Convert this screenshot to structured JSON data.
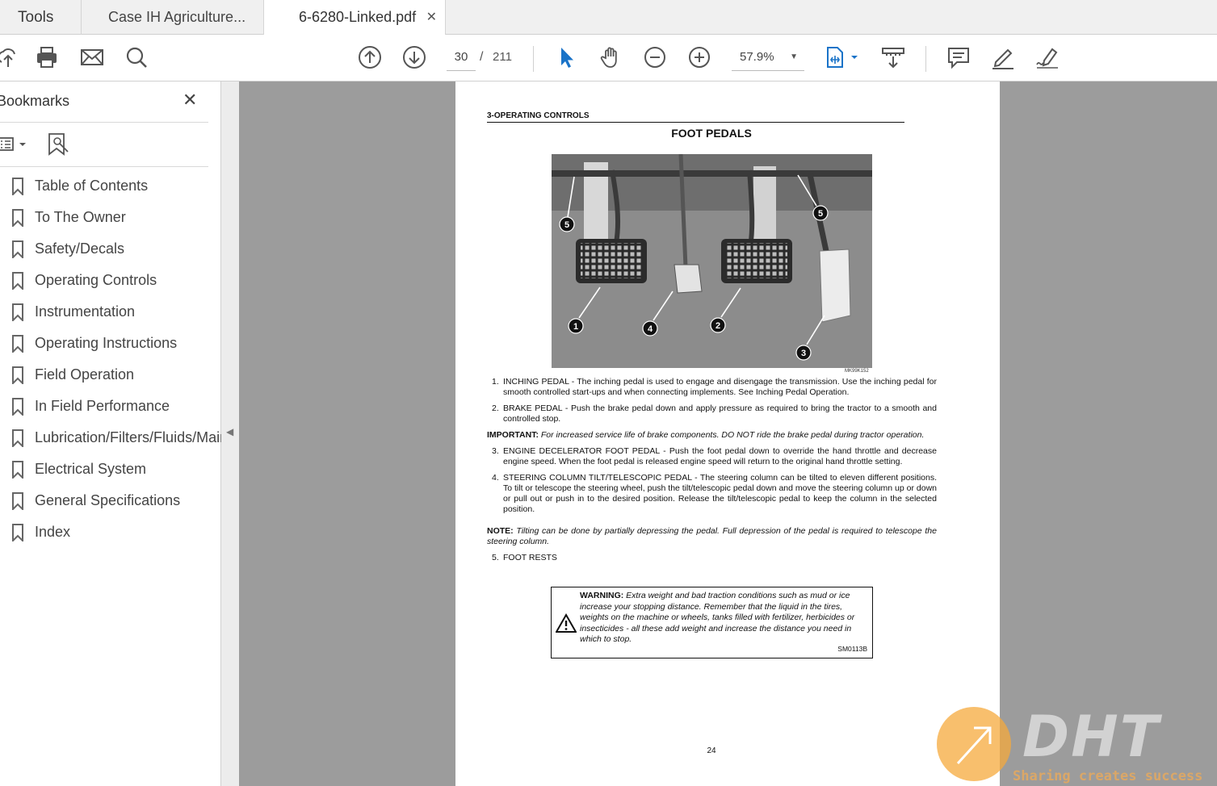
{
  "tabs": {
    "tools": "Tools",
    "doc1": "Case IH Agriculture...",
    "doc2": "6-6280-Linked.pdf",
    "close": "✕"
  },
  "toolbar": {
    "current_page": "30",
    "separator": "/",
    "total_pages": "211",
    "zoom": "57.9%",
    "accent": "#1a73c8"
  },
  "sidebar": {
    "title": "Bookmarks",
    "close": "✕",
    "bookmarks": [
      "Table of Contents",
      "To The Owner",
      "Safety/Decals",
      "Operating Controls",
      "Instrumentation",
      "Operating Instructions",
      "Field Operation",
      "In Field Performance",
      "Lubrication/Filters/Fluids/Maintenance",
      "Electrical System",
      "General Specifications",
      "Index"
    ]
  },
  "document": {
    "section": "3-OPERATING CONTROLS",
    "title": "FOOT PEDALS",
    "photo_code": "MK99K152",
    "callouts": [
      "1",
      "2",
      "3",
      "4",
      "5",
      "5"
    ],
    "items": [
      {
        "n": "1.",
        "text": "INCHING PEDAL - The inching pedal is used to engage and disengage the transmission. Use the inching pedal for smooth controlled start-ups and when connecting implements. See Inching Pedal Operation."
      },
      {
        "n": "2.",
        "text": "BRAKE PEDAL - Push the brake pedal down and apply pressure as required to bring the tractor to a smooth and controlled stop."
      }
    ],
    "important_label": "IMPORTANT:",
    "important_text": "For increased service life of brake components. DO NOT ride the brake pedal during tractor operation.",
    "items2": [
      {
        "n": "3.",
        "text": "ENGINE DECELERATOR FOOT PEDAL - Push the foot pedal down to override the hand throttle and decrease engine speed. When the foot pedal is released engine speed will return to the original hand throttle setting."
      },
      {
        "n": "4.",
        "text": "STEERING COLUMN TILT/TELESCOPIC PEDAL - The steering column can be tilted to eleven different positions. To tilt or telescope the steering wheel, push the tilt/telescopic pedal down and move the steering column up or down or pull out or push in to the desired position. Release the tilt/telescopic pedal to keep the column in the selected position."
      }
    ],
    "note_label": "NOTE:",
    "note_text": "Tilting can be done by partially depressing the pedal. Full depression of the pedal is required to telescope the steering column.",
    "item5": {
      "n": "5.",
      "text": "FOOT RESTS"
    },
    "warning_label": "WARNING:",
    "warning_text": "Extra weight and bad traction conditions such as mud or ice increase your stopping distance. Remember that the liquid in the tires, weights on the machine or wheels, tanks filled with fertilizer, herbicides or insecticides - all these add weight and increase the distance you need in which to stop.",
    "warning_code": "SM0113B",
    "page_number": "24"
  },
  "watermark": {
    "logo": "DHT",
    "tagline": "Sharing creates success"
  }
}
